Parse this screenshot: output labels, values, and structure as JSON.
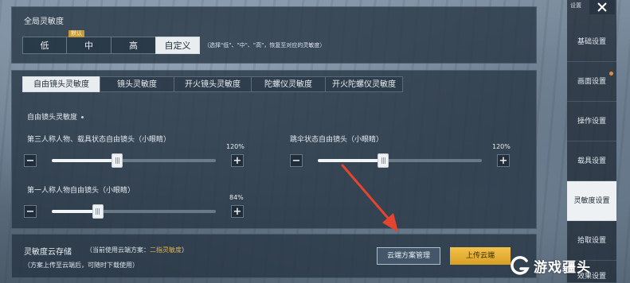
{
  "global": {
    "title": "全局灵敏度",
    "presets": [
      {
        "label": "低",
        "selected": false
      },
      {
        "label": "中",
        "selected": false,
        "tag": "默认"
      },
      {
        "label": "高",
        "selected": false
      },
      {
        "label": "自定义",
        "selected": true
      }
    ],
    "hint": "（选择\"低\"、\"中\"、\"高\"，恢复至对应的灵敏度）"
  },
  "tabs": [
    {
      "label": "自由镜头灵敏度",
      "selected": true
    },
    {
      "label": "镜头灵敏度",
      "selected": false
    },
    {
      "label": "开火镜头灵敏度",
      "selected": false
    },
    {
      "label": "陀螺仪灵敏度",
      "selected": false
    },
    {
      "label": "开火陀螺仪灵敏度",
      "selected": false
    }
  ],
  "free_look": {
    "title": "自由镜头灵敏度",
    "sliders": [
      {
        "label": "第三人称人物、载具状态自由镜头（小眼睛）",
        "value_text": "120%",
        "fraction": 0.4
      },
      {
        "label": "跳伞状态自由镜头（小眼睛）",
        "value_text": "120%",
        "fraction": 0.4
      },
      {
        "label": "第一人称人物自由镜头（小眼睛）",
        "value_text": "84%",
        "fraction": 0.28
      }
    ]
  },
  "cloud": {
    "title": "灵敏度云存储",
    "scheme_prefix": "（当前使用云端方案：",
    "scheme_name": "二指灵敏度",
    "scheme_suffix": "）",
    "note": "（方案上传至云端后，可随时下载使用）",
    "manage_label": "云端方案管理",
    "upload_label": "上传云端"
  },
  "sidebar": {
    "top_label": "设置",
    "items": [
      {
        "label": "基础设置",
        "selected": false,
        "dot": false
      },
      {
        "label": "画面设置",
        "selected": false,
        "dot": true
      },
      {
        "label": "操作设置",
        "selected": false,
        "dot": false
      },
      {
        "label": "载具设置",
        "selected": false,
        "dot": false
      },
      {
        "label": "灵敏度设置",
        "selected": true,
        "dot": false
      },
      {
        "label": "拾取设置",
        "selected": false,
        "dot": false
      },
      {
        "label": "效果设置",
        "selected": false,
        "dot": false
      }
    ]
  },
  "stepper": {
    "minus": "−",
    "plus": "+"
  },
  "watermark": {
    "text": "游戏疆头"
  },
  "colors": {
    "accent": "#e3b64a",
    "upload_button": "#f3c24a",
    "arrow": "#e5452f"
  }
}
